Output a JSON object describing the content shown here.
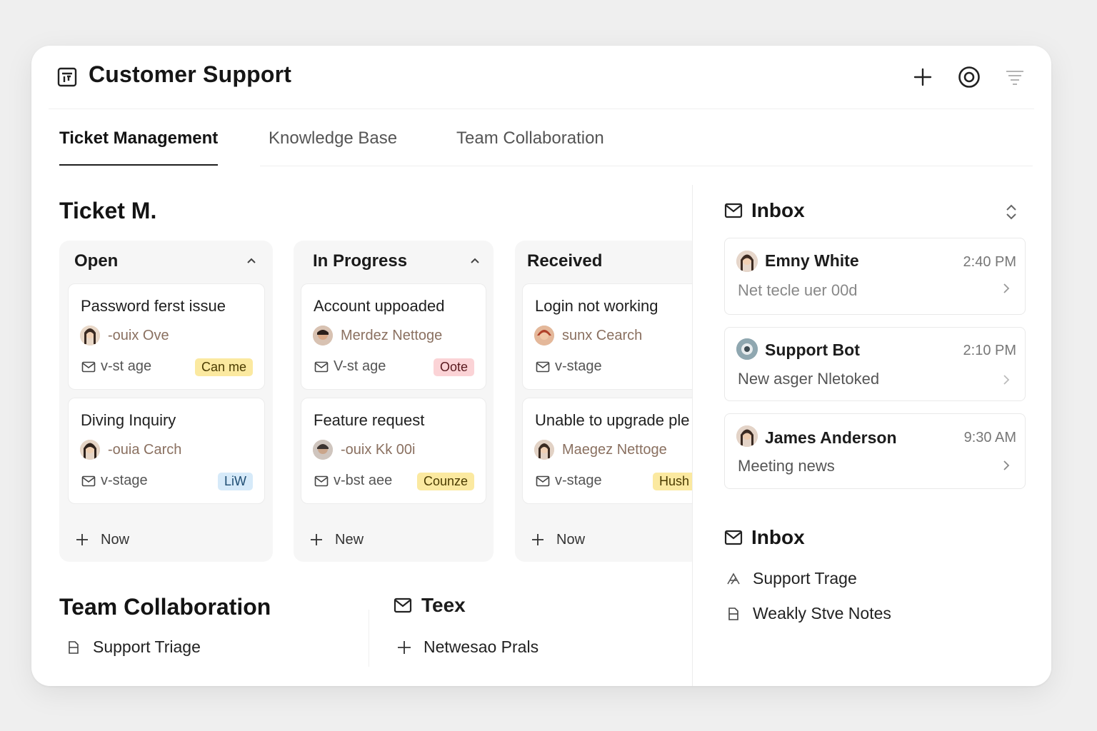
{
  "header": {
    "title": "Customer Support",
    "icon": "board-icon",
    "actions": [
      "plus-icon",
      "target-icon",
      "filter-icon"
    ]
  },
  "tabs": [
    {
      "label": "Ticket Management",
      "active": true
    },
    {
      "label": "Knowledge Base",
      "active": false
    },
    {
      "label": "Team Collaboration",
      "active": false
    }
  ],
  "board": {
    "title": "Ticket M.",
    "columns": [
      {
        "title": "Open",
        "add_label": "Now",
        "cards": [
          {
            "title": "Password ferst issue",
            "assignee": "-ouix Ove",
            "meta": "v-st age",
            "badge": "Can me",
            "badge_bg": "#fbe9a0",
            "badge_fg": "#4a3b00"
          },
          {
            "title": "Diving Inquiry",
            "assignee": "-ouia Carch",
            "meta": "v-stage",
            "badge": "LiW",
            "badge_bg": "#d6eaf9",
            "badge_fg": "#1f4d72"
          }
        ]
      },
      {
        "title": "In Progress",
        "add_label": "New",
        "cards": [
          {
            "title": "Account uppoaded",
            "assignee": "Merdez Nettoge",
            "meta": "V-st age",
            "badge": "Oote",
            "badge_bg": "#fbd3d6",
            "badge_fg": "#5a1a1f"
          },
          {
            "title": "Feature request",
            "assignee": "-ouix Kk 00i",
            "meta": "v-bst aee",
            "badge": "Counze",
            "badge_bg": "#fbe9a0",
            "badge_fg": "#4a3b00"
          }
        ]
      },
      {
        "title": "Received",
        "add_label": "Now",
        "cards": [
          {
            "title": "Login not working",
            "assignee": "sunx Cearch",
            "meta": "v-stage",
            "badge": "",
            "badge_bg": "",
            "badge_fg": ""
          },
          {
            "title": "Unable to upgrade ple",
            "assignee": "Maegez Nettoge",
            "meta": "v-stage",
            "badge": "Hush",
            "badge_bg": "#fbe9a0",
            "badge_fg": "#4a3b00"
          }
        ]
      }
    ]
  },
  "team_section": {
    "title": "Team Collaboration",
    "item": "Support Triage",
    "teex_title": "Teex",
    "teex_item": "Netwesao Prals"
  },
  "inbox": {
    "title": "Inbox",
    "messages": [
      {
        "name": "Emny White",
        "time": "2:40 PM",
        "preview": "Net tecle uer 00d"
      },
      {
        "name": "Support Bot",
        "time": "2:10 PM",
        "preview": "New asger Nletoked"
      },
      {
        "name": "James Anderson",
        "time": "9:30 AM",
        "preview": "Meeting news"
      }
    ]
  },
  "inbox2": {
    "title": "Inbox",
    "items": [
      "Support Trage",
      "Weakly Stve Notes"
    ]
  }
}
